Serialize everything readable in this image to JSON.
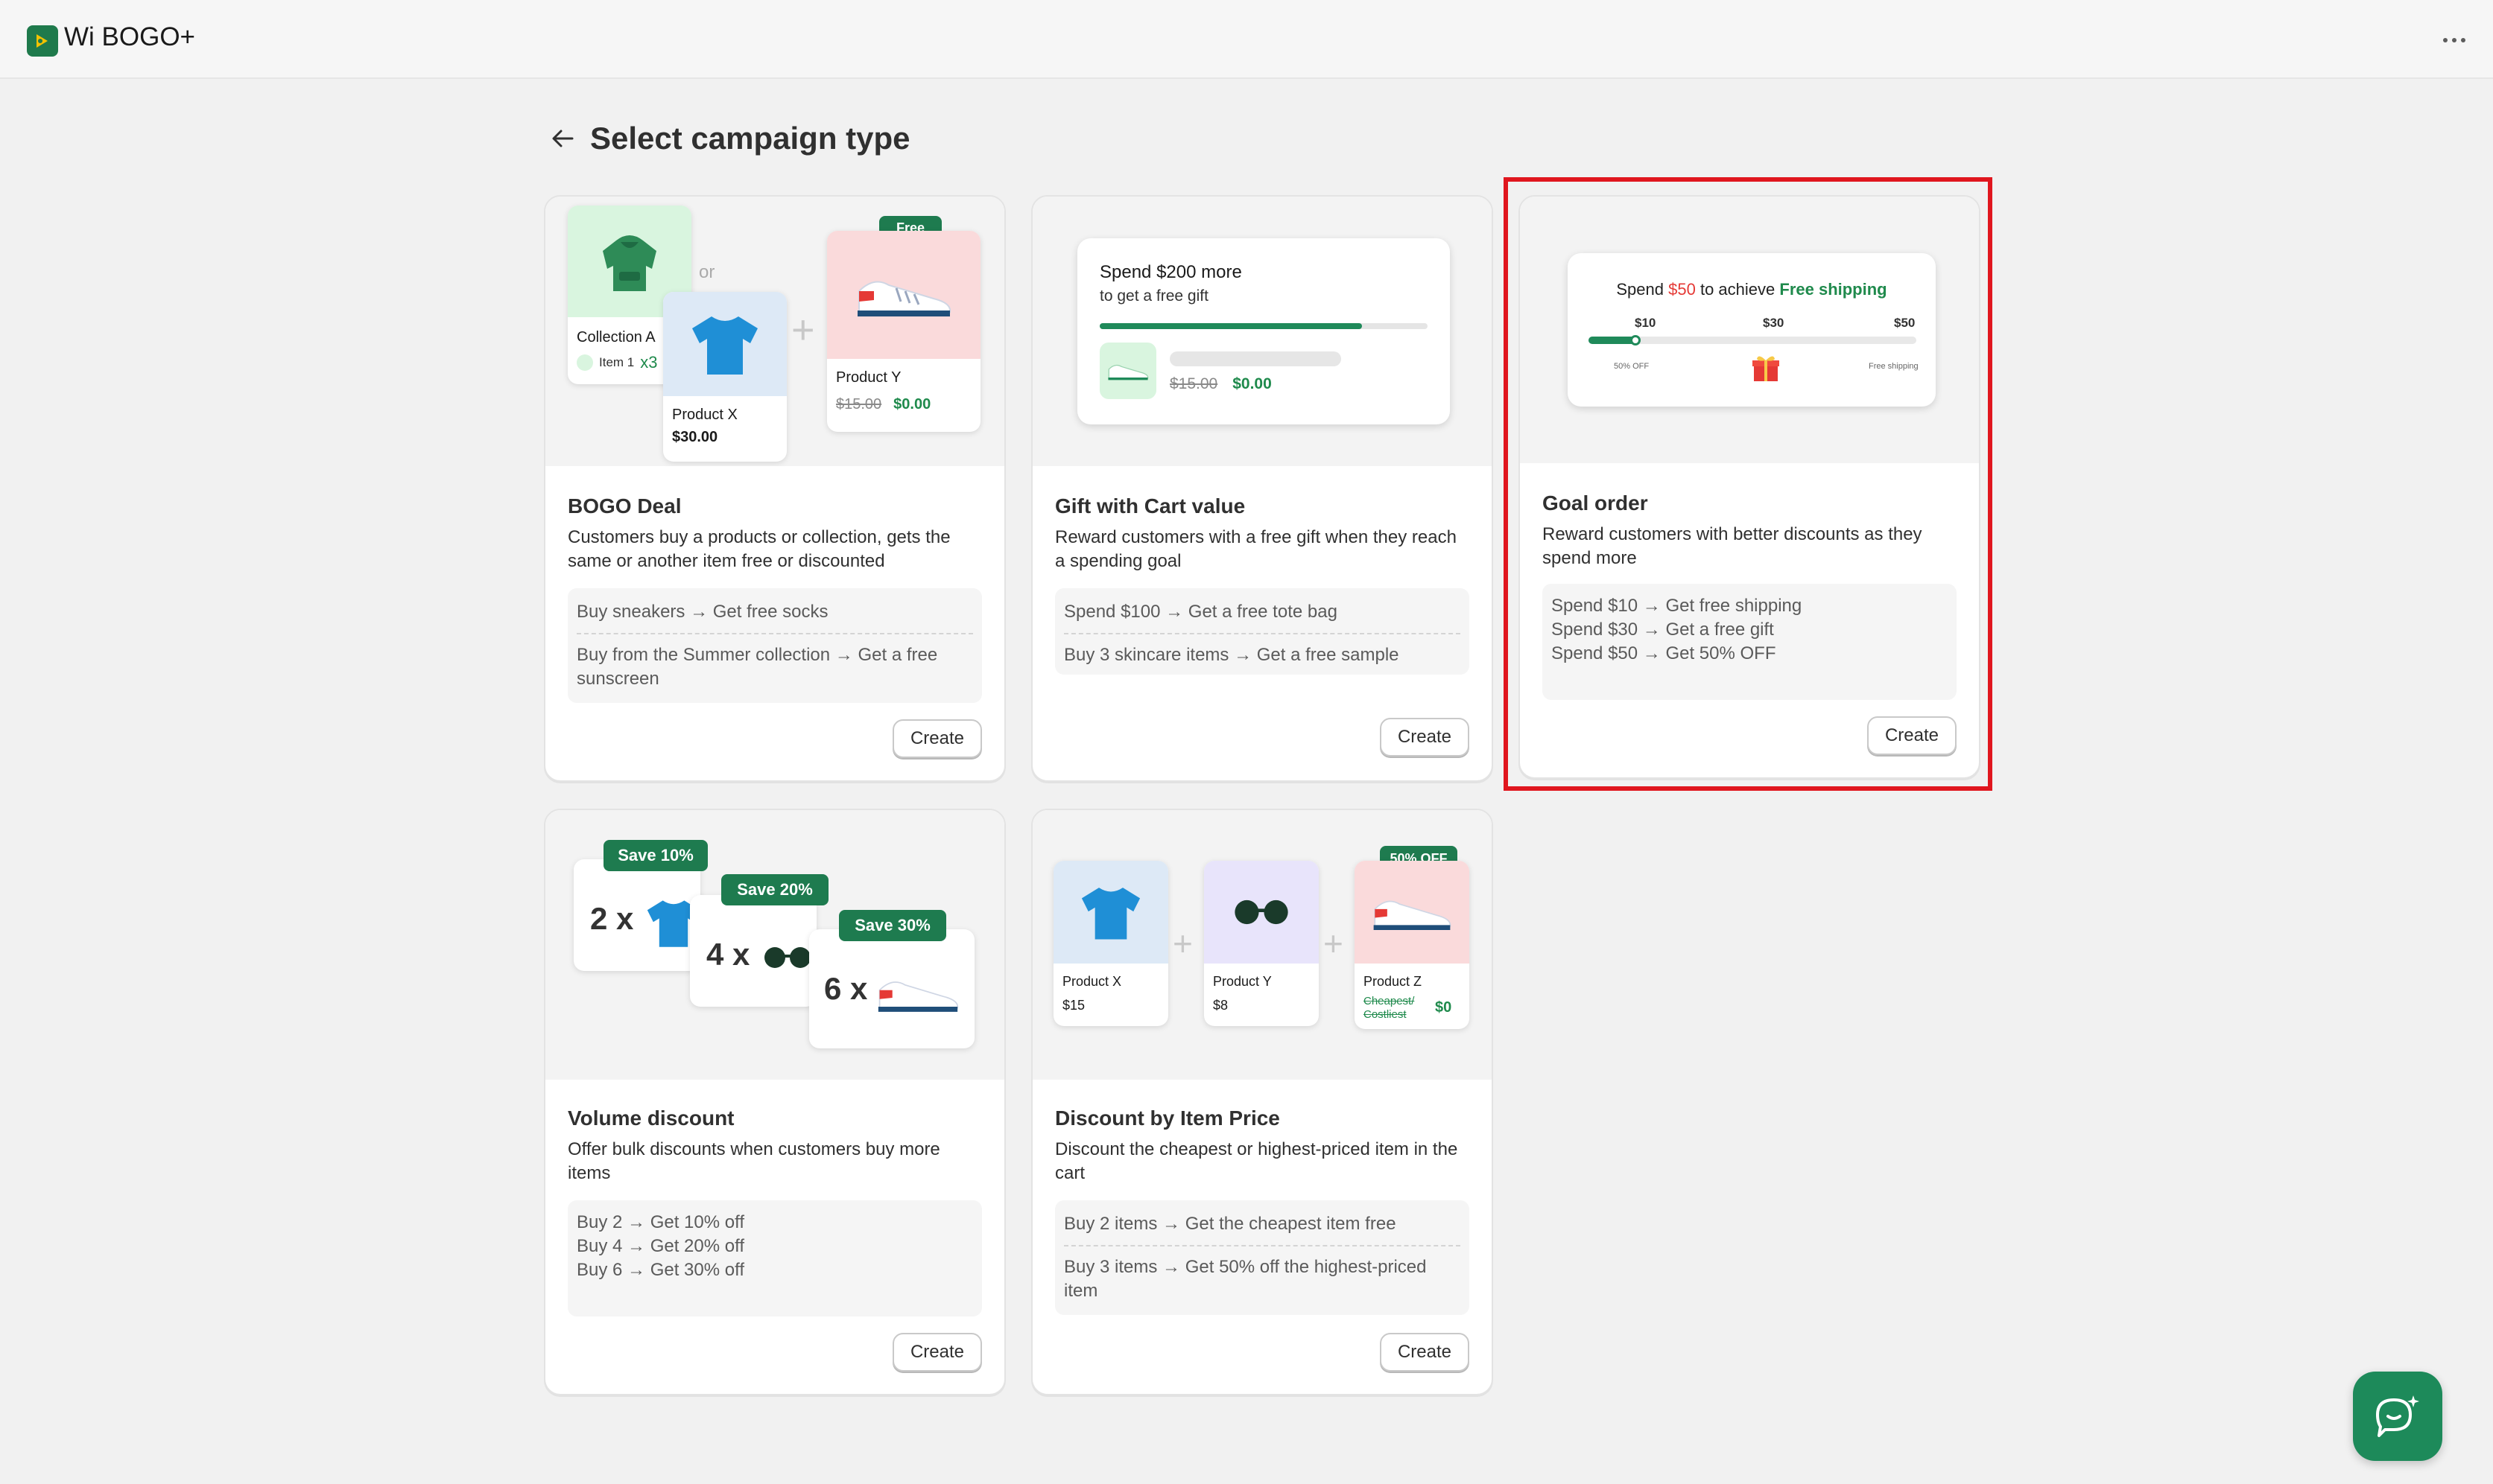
{
  "app": {
    "title": "Wi BOGO+"
  },
  "page": {
    "title": "Select campaign type"
  },
  "colors": {
    "brand": "#1f7a4c",
    "highlight": "#e0161e",
    "accent_red": "#e53935"
  },
  "cards": [
    {
      "id": "bogo",
      "title": "BOGO Deal",
      "description": "Customers buy a products or collection, gets the same or another item free or discounted",
      "examples": [
        "Buy sneakers → Get free socks",
        "Buy from the Summer collection → Get a free sunscreen"
      ],
      "create_label": "Create",
      "hero": {
        "collection_label": "Collection A",
        "item_label": "Item 1",
        "item_qty": "x3",
        "or_label": "or",
        "product_x_label": "Product X",
        "product_x_price": "$30.00",
        "free_badge": "Free",
        "product_y_label": "Product Y",
        "product_y_old_price": "$15.00",
        "product_y_new_price": "$0.00"
      }
    },
    {
      "id": "gift",
      "title": "Gift with Cart value",
      "description": "Reward customers with a free gift when they reach a spending goal",
      "examples": [
        "Spend $100 → Get a free tote bag",
        "Buy 3 skincare items → Get a free sample"
      ],
      "create_label": "Create",
      "hero": {
        "headline": "Spend $200 more",
        "subline": "to get a free gift",
        "progress": 0.8,
        "old_price": "$15.00",
        "new_price": "$0.00"
      }
    },
    {
      "id": "goal",
      "title": "Goal order",
      "description": "Reward customers with better discounts as they spend more",
      "examples": [
        "Spend $10 → Get free shipping",
        "Spend $30 → Get a free gift",
        "Spend $50 → Get 50% OFF"
      ],
      "create_label": "Create",
      "hero": {
        "text_pre": "Spend",
        "amount": "$50",
        "text_mid": "to achieve",
        "reward": "Free shipping",
        "tiers": [
          "$10",
          "$30",
          "$50"
        ],
        "tier_labels": [
          "50% OFF",
          "Free shipping"
        ],
        "progress": 0.15
      }
    },
    {
      "id": "volume",
      "title": "Volume discount",
      "description": "Offer bulk discounts when customers buy more items",
      "examples": [
        "Buy 2 → Get 10% off",
        "Buy 4 → Get 20% off",
        "Buy 6 → Get 30% off"
      ],
      "create_label": "Create",
      "hero": {
        "tiers": [
          {
            "badge": "Save  10%",
            "qty": "2 x"
          },
          {
            "badge": "Save  20%",
            "qty": "4 x"
          },
          {
            "badge": "Save  30%",
            "qty": "6 x"
          }
        ]
      }
    },
    {
      "id": "price",
      "title": "Discount by Item Price",
      "description": "Discount the cheapest or highest-priced item in the cart",
      "examples": [
        "Buy 2 items → Get the cheapest item free",
        "Buy 3 items → Get 50% off the highest-priced item"
      ],
      "create_label": "Create",
      "hero": {
        "products": [
          {
            "name": "Product X",
            "price": "$15"
          },
          {
            "name": "Product Y",
            "price": "$8"
          },
          {
            "name": "Product Z",
            "price_old": "Cheapest/ Costliest",
            "price_new": "$0"
          }
        ],
        "badge": "50% OFF"
      }
    }
  ]
}
